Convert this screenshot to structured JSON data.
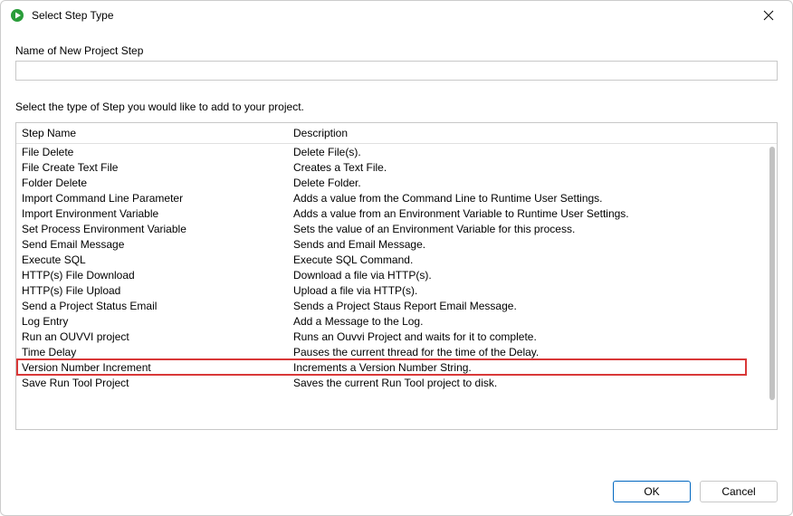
{
  "window": {
    "title": "Select Step Type"
  },
  "form": {
    "name_label": "Name of New Project Step",
    "name_value": "",
    "instruction": "Select the type of Step you would like to add to your project."
  },
  "grid": {
    "col_name": "Step Name",
    "col_desc": "Description",
    "rows": [
      {
        "name": "File Delete",
        "desc": "Delete File(s)."
      },
      {
        "name": "File Create Text File",
        "desc": "Creates a Text File."
      },
      {
        "name": "Folder Delete",
        "desc": "Delete Folder."
      },
      {
        "name": "Import Command Line Parameter",
        "desc": "Adds a value from the Command Line to Runtime User Settings."
      },
      {
        "name": "Import Environment Variable",
        "desc": "Adds a value from an Environment Variable to Runtime User Settings."
      },
      {
        "name": "Set Process Environment Variable",
        "desc": "Sets the value of an Environment Variable for this process."
      },
      {
        "name": "Send Email Message",
        "desc": "Sends and Email Message."
      },
      {
        "name": "Execute SQL",
        "desc": "Execute SQL Command."
      },
      {
        "name": "HTTP(s) File Download",
        "desc": "Download a file via HTTP(s)."
      },
      {
        "name": "HTTP(s) File Upload",
        "desc": "Upload a file via HTTP(s)."
      },
      {
        "name": "Send a Project Status Email",
        "desc": "Sends a Project Staus Report Email Message."
      },
      {
        "name": "Log Entry",
        "desc": "Add a Message to the Log."
      },
      {
        "name": "Run an OUVVI project",
        "desc": "Runs an Ouvvi Project and waits for it to complete."
      },
      {
        "name": "Time Delay",
        "desc": "Pauses the current thread for the time of the Delay."
      },
      {
        "name": "Version Number Increment",
        "desc": "Increments a Version Number String."
      },
      {
        "name": "Save Run Tool Project",
        "desc": "Saves the current Run Tool project to disk."
      }
    ],
    "highlight_index": 14
  },
  "buttons": {
    "ok": "OK",
    "cancel": "Cancel"
  }
}
